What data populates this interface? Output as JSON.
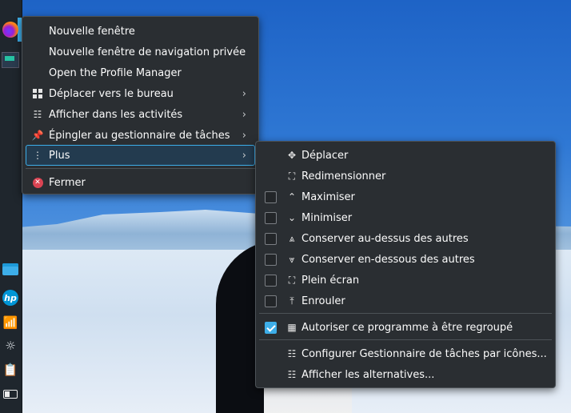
{
  "main_menu": {
    "items": [
      {
        "label": "Nouvelle fenêtre",
        "icon": "none"
      },
      {
        "label": "Nouvelle fenêtre de navigation privée",
        "icon": "none"
      },
      {
        "label": "Open the Profile Manager",
        "icon": "none"
      },
      {
        "label": "Déplacer vers le bureau",
        "icon": "desktops-icon",
        "submenu": true
      },
      {
        "label": "Afficher dans les activités",
        "icon": "activities-icon",
        "submenu": true
      },
      {
        "label": "Épingler au gestionnaire de tâches",
        "icon": "pin-icon",
        "submenu": true
      },
      {
        "label": "Plus",
        "icon": "more-icon",
        "submenu": true,
        "highlighted": true
      },
      {
        "label": "Fermer",
        "icon": "close-icon"
      }
    ]
  },
  "sub_menu": {
    "items": [
      {
        "label": "Déplacer",
        "icon": "move-icon"
      },
      {
        "label": "Redimensionner",
        "icon": "resize-icon"
      },
      {
        "label": "Maximiser",
        "icon": "maximize-icon",
        "checkbox": true,
        "checked": false
      },
      {
        "label": "Minimiser",
        "icon": "minimize-icon",
        "checkbox": true,
        "checked": false
      },
      {
        "label": "Conserver au-dessus des autres",
        "icon": "keep-above-icon",
        "checkbox": true,
        "checked": false
      },
      {
        "label": "Conserver en-dessous des autres",
        "icon": "keep-below-icon",
        "checkbox": true,
        "checked": false
      },
      {
        "label": "Plein écran",
        "icon": "fullscreen-icon",
        "checkbox": true,
        "checked": false
      },
      {
        "label": "Enrouler",
        "icon": "shade-icon",
        "checkbox": true,
        "checked": false
      },
      {
        "label": "Autoriser ce programme à être regroupé",
        "icon": "group-icon",
        "checkbox": true,
        "checked": true
      },
      {
        "label": "Configurer Gestionnaire de tâches par icônes...",
        "icon": "configure-icon"
      },
      {
        "label": "Afficher les alternatives...",
        "icon": "alternatives-icon"
      }
    ]
  },
  "panel": {
    "icons": [
      "firefox-icon",
      "window-icon",
      "folder-icon",
      "hp-icon",
      "wifi-icon",
      "brightness-icon",
      "clipboard-icon",
      "battery-icon"
    ],
    "hp_text": "hp"
  },
  "colors": {
    "menu_bg": "#2a2e32",
    "highlight_border": "#3daee9",
    "highlight_bg": "#233b4f",
    "close_red": "#da4453"
  }
}
